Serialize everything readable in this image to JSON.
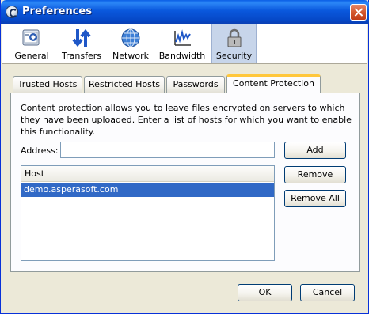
{
  "window": {
    "title": "Preferences"
  },
  "toolbar": {
    "items": [
      {
        "label": "General",
        "icon": "general-icon"
      },
      {
        "label": "Transfers",
        "icon": "transfers-icon"
      },
      {
        "label": "Network",
        "icon": "network-icon"
      },
      {
        "label": "Bandwidth",
        "icon": "bandwidth-icon"
      },
      {
        "label": "Security",
        "icon": "lock-icon",
        "selected": true
      }
    ]
  },
  "tabs": [
    {
      "label": "Trusted Hosts"
    },
    {
      "label": "Restricted Hosts"
    },
    {
      "label": "Passwords"
    },
    {
      "label": "Content Protection",
      "selected": true
    }
  ],
  "content": {
    "description": "Content protection allows you to leave files encrypted on servers to which they have been uploaded.  Enter a list of hosts for which you want to enable this functionality.",
    "address_label": "Address:",
    "address_value": "",
    "add_label": "Add",
    "remove_label": "Remove",
    "remove_all_label": "Remove All",
    "host_column": "Host",
    "hosts": [
      "demo.asperasoft.com"
    ]
  },
  "footer": {
    "ok_label": "OK",
    "cancel_label": "Cancel"
  },
  "colors": {
    "selection": "#3169C6",
    "tab_accent": "#FFC73C",
    "titlebar": "#0A58DD"
  }
}
